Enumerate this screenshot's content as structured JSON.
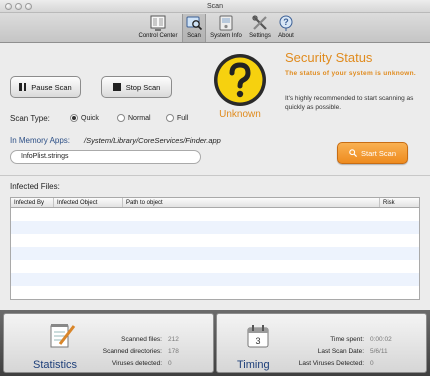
{
  "window": {
    "title": "Scan"
  },
  "toolbar": {
    "items": [
      {
        "label": "Control Center",
        "icon": "control-center-icon"
      },
      {
        "label": "Scan",
        "icon": "scan-icon",
        "active": true
      },
      {
        "label": "System Info",
        "icon": "system-info-icon"
      },
      {
        "label": "Settings",
        "icon": "settings-icon"
      },
      {
        "label": "About",
        "icon": "about-icon"
      }
    ]
  },
  "controls": {
    "pause_label": "Pause Scan",
    "stop_label": "Stop Scan",
    "scan_type_label": "Scan Type:",
    "scan_types": [
      "Quick",
      "Normal",
      "Full"
    ],
    "selected_scan_type": "Quick",
    "in_memory_label": "In Memory Apps:",
    "in_memory_path": "/System/Library/CoreServices/Finder.app",
    "current_file": "InfoPlist.strings"
  },
  "status": {
    "title": "Security Status",
    "subtitle": "The status of your system is unknown.",
    "description": "It's highly recommended to start scanning as quickly as possible.",
    "badge": "Unknown",
    "start_label": "Start Scan",
    "accent": "#e08b1e"
  },
  "infected": {
    "title": "Infected Files:",
    "columns": [
      "Infected By",
      "Infected Object",
      "Path to object",
      "Risk"
    ],
    "rows": []
  },
  "statistics": {
    "title": "Statistics",
    "items": [
      {
        "label": "Scanned files:",
        "value": "212"
      },
      {
        "label": "Scanned directories:",
        "value": "178"
      },
      {
        "label": "Viruses detected:",
        "value": "0"
      }
    ]
  },
  "timing": {
    "title": "Timing",
    "calendar_day": "3",
    "items": [
      {
        "label": "Time spent:",
        "value": "0:00:02"
      },
      {
        "label": "Last Scan Date:",
        "value": "5/6/11"
      },
      {
        "label": "Last Viruses Detected:",
        "value": "0"
      }
    ]
  }
}
